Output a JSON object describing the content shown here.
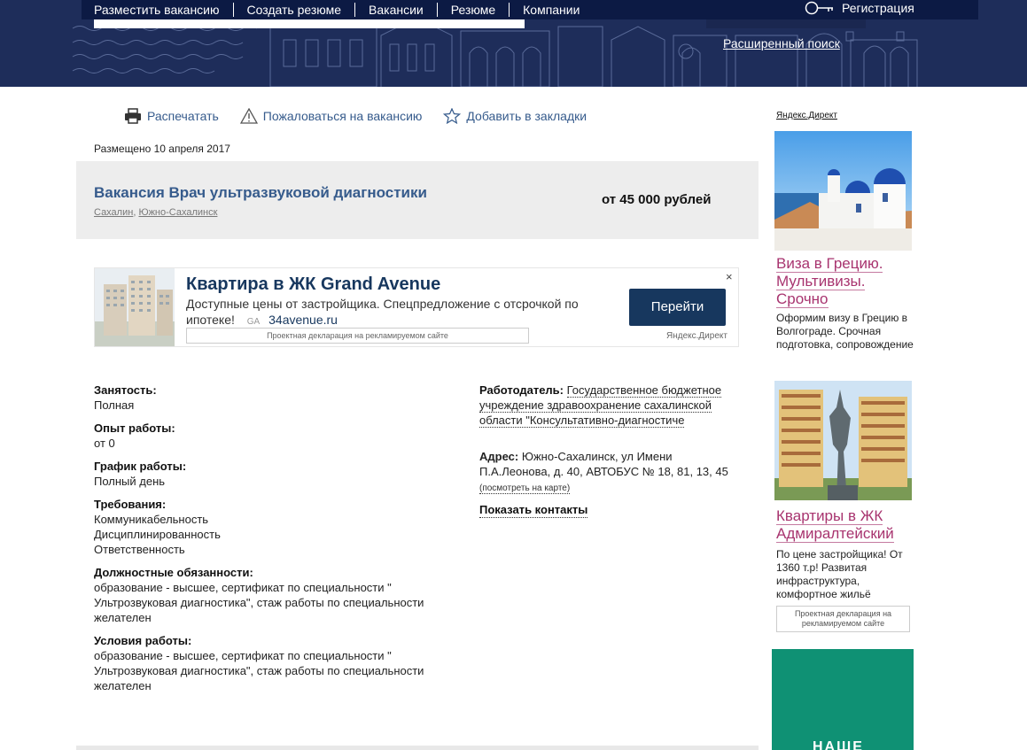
{
  "nav": {
    "items": [
      "Разместить вакансию",
      "Создать резюме",
      "Вакансии",
      "Резюме",
      "Компании"
    ],
    "register": "Регистрация",
    "advanced_search": "Расширенный поиск"
  },
  "toolbar": {
    "print": "Распечатать",
    "complain": "Пожаловаться на вакансию",
    "bookmark": "Добавить в закладки"
  },
  "posted": "Размещено 10 апреля 2017",
  "vacancy": {
    "title": "Вакансия Врач ультразвуковой диагностики",
    "region": "Сахалин",
    "city": "Южно-Сахалинск",
    "salary": "от 45 000 рублей"
  },
  "ad_inline": {
    "title": "Квартира в ЖК Grand Avenue",
    "text": "Доступные цены от застройщика. Спецпредложение с отсрочкой по ипотеке!",
    "ga": "GA",
    "domain": "34avenue.ru",
    "declaration": "Проектная декларация на рекламируемом сайте",
    "button": "Перейти",
    "close": "×",
    "direct": "Яндекс.Директ"
  },
  "details": {
    "employment_label": "Занятость:",
    "employment": "Полная",
    "experience_label": "Опыт работы:",
    "experience": "от 0",
    "schedule_label": "График работы:",
    "schedule": "Полный день",
    "requirements_label": "Требования:",
    "requirements": [
      "Коммуникабельность",
      "Дисциплинированность",
      "Ответственность"
    ],
    "duties_label": "Должностные обязанности:",
    "duties": "образование - высшее, сертификат по специальности \" Ультрозвуковая диагностика\", стаж работы по специальности желателен",
    "conditions_label": "Условия работы:",
    "conditions": "образование - высшее, сертификат по специальности \" Ультрозвуковая диагностика\", стаж работы по специальности желателен"
  },
  "employer": {
    "label": "Работодатель:",
    "name": "Государственное бюджетное учреждение здравоохранение сахалинской области \"Консультативно-диагностиче",
    "address_label": "Адрес:",
    "address": "Южно-Сахалинск, ул Имени П.А.Леонова, д. 40, АВТОБУС № 18, 81, 13, 45",
    "map_link": "(посмотреть на карте)",
    "contacts": "Показать контакты"
  },
  "right_ads": {
    "direct": "Яндекс.Директ",
    "ad1_title": "Виза в Грецию. Мультивизы. Срочно",
    "ad1_text": "Оформим визу в Грецию в Волгограде. Срочная подготовка, сопровождение",
    "ad2_title": "Квартиры в ЖК Адмиралтейский",
    "ad2_text": "По цене застройщика! От 1360 т.р! Развитая инфраструктура, комфортное жильё",
    "ad2_declaration": "Проектная декларация на рекламируемом сайте",
    "ad3_text": "НАШЕ"
  },
  "colors": {
    "header_bg": "#1e2d5a",
    "nav_bg": "#0c1a44",
    "link": "#365b8c",
    "ad_title": "#a8346f",
    "ad_button": "#17375e",
    "teal": "#0f9174"
  }
}
